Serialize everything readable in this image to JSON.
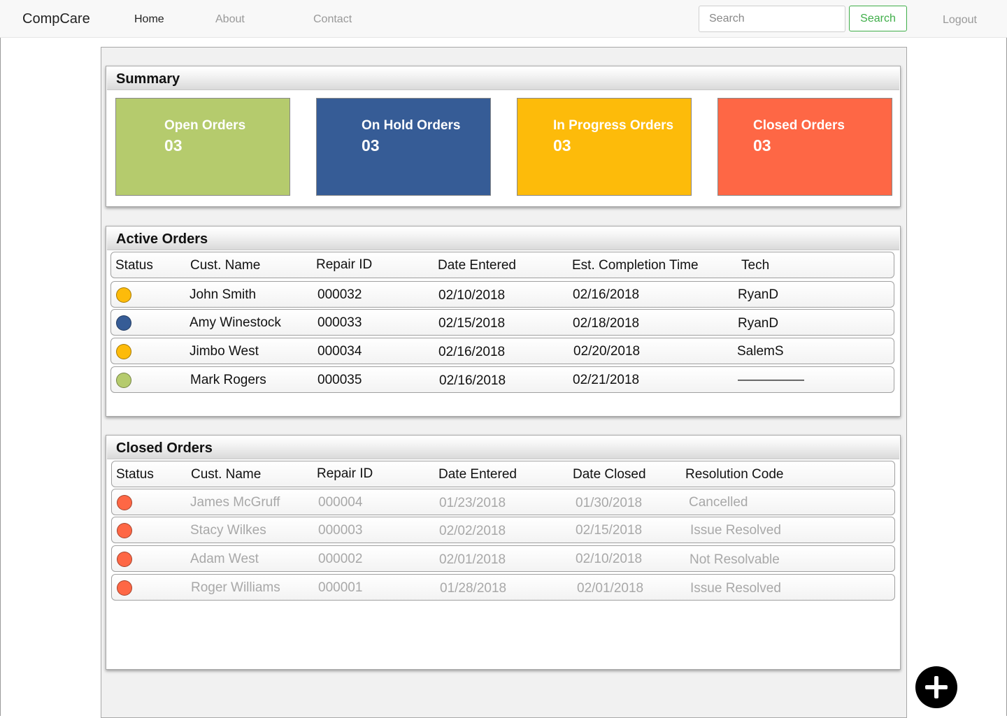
{
  "app": {
    "brand": "CompCare"
  },
  "nav": {
    "home": "Home",
    "about": "About",
    "contact": "Contact",
    "logout": "Logout"
  },
  "search": {
    "placeholder": "Search",
    "button": "Search"
  },
  "summary": {
    "title": "Summary",
    "cards": [
      {
        "label": "Open Orders",
        "count": "03",
        "color": "#b5cb6d"
      },
      {
        "label": "On Hold Orders",
        "count": "03",
        "color": "#365c96"
      },
      {
        "label": "In Progress Orders",
        "count": "03",
        "color": "#fdbb0a"
      },
      {
        "label": "Closed Orders",
        "count": "03",
        "color": "#fe6745"
      }
    ]
  },
  "active_orders": {
    "title": "Active Orders",
    "columns": [
      "Status",
      "Cust. Name",
      "Repair ID",
      "Date Entered",
      "Est. Completion Time",
      "Tech"
    ],
    "rows": [
      {
        "status_color": "#fdbb0a",
        "name": "John Smith",
        "repair_id": "000032",
        "date_entered": "02/10/2018",
        "est_completion": "02/16/2018",
        "tech": "RyanD"
      },
      {
        "status_color": "#365c96",
        "name": "Amy Winestock",
        "repair_id": "000033",
        "date_entered": "02/15/2018",
        "est_completion": "02/18/2018",
        "tech": "RyanD"
      },
      {
        "status_color": "#fdbb0a",
        "name": "Jimbo West",
        "repair_id": "000034",
        "date_entered": "02/16/2018",
        "est_completion": "02/20/2018",
        "tech": "SalemS"
      },
      {
        "status_color": "#b5cb6d",
        "name": "Mark Rogers",
        "repair_id": "000035",
        "date_entered": "02/16/2018",
        "est_completion": "02/21/2018",
        "tech": "—————"
      }
    ]
  },
  "closed_orders": {
    "title": "Closed Orders",
    "columns": [
      "Status",
      "Cust. Name",
      "Repair ID",
      "Date Entered",
      "Date Closed",
      "Resolution Code"
    ],
    "rows": [
      {
        "status_color": "#fe6745",
        "name": "James McGruff",
        "repair_id": "000004",
        "date_entered": "01/23/2018",
        "date_closed": "01/30/2018",
        "resolution": "Cancelled"
      },
      {
        "status_color": "#fe6745",
        "name": "Stacy Wilkes",
        "repair_id": "000003",
        "date_entered": "02/02/2018",
        "date_closed": "02/15/2018",
        "resolution": "Issue Resolved"
      },
      {
        "status_color": "#fe6745",
        "name": "Adam West",
        "repair_id": "000002",
        "date_entered": "02/01/2018",
        "date_closed": "02/10/2018",
        "resolution": "Not Resolvable"
      },
      {
        "status_color": "#fe6745",
        "name": "Roger Williams",
        "repair_id": "000001",
        "date_entered": "01/28/2018",
        "date_closed": "02/01/2018",
        "resolution": "Issue Resolved"
      }
    ]
  },
  "fab": {
    "icon": "plus-icon"
  }
}
